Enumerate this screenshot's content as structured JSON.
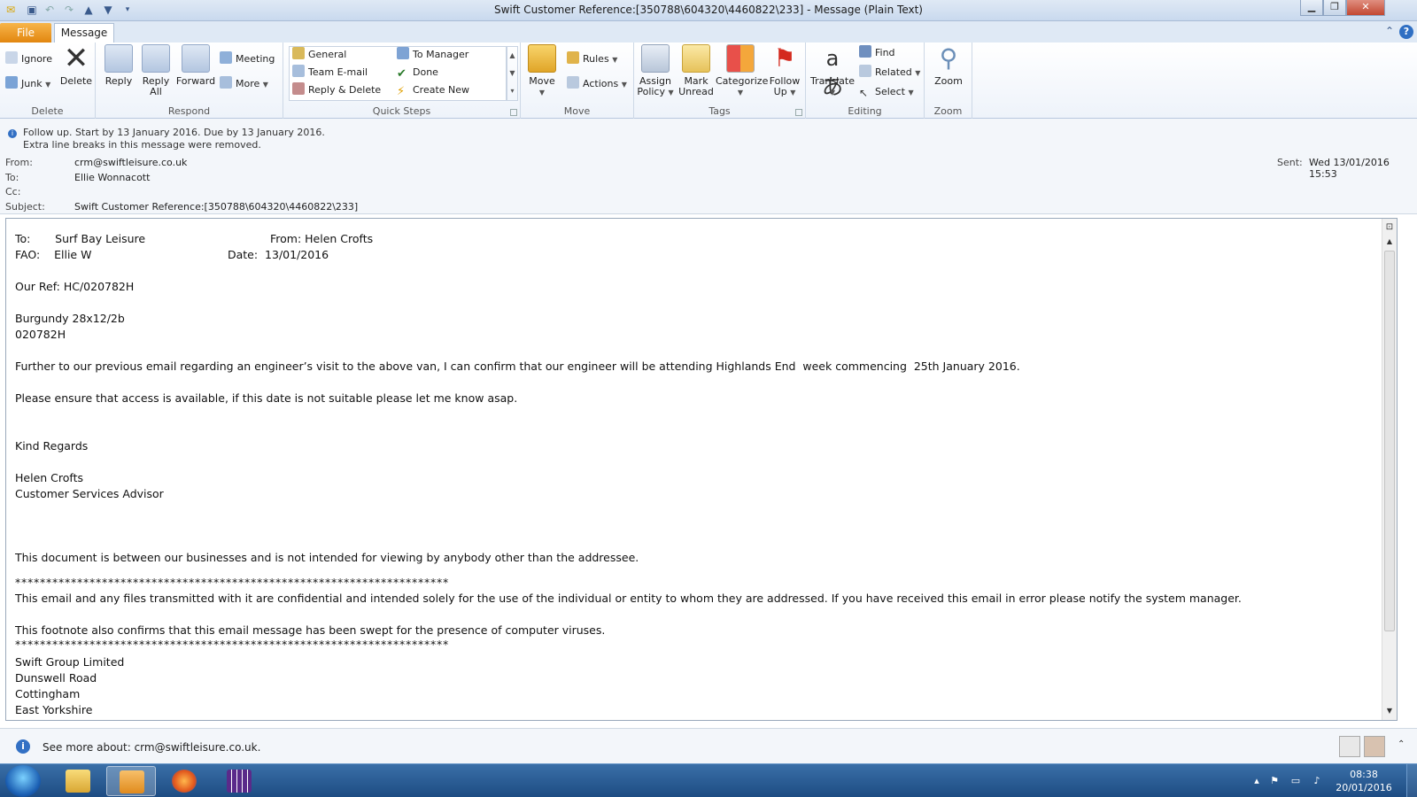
{
  "window": {
    "title": "Swift Customer Reference:[350788\\604320\\4460822\\233]  -  Message (Plain Text)"
  },
  "tabs": {
    "file": "File",
    "message": "Message"
  },
  "ribbon": {
    "delete_group": {
      "label": "Delete",
      "ignore": "Ignore",
      "junk": "Junk",
      "delete": "Delete"
    },
    "respond_group": {
      "label": "Respond",
      "reply": "Reply",
      "reply_all_1": "Reply",
      "reply_all_2": "All",
      "forward": "Forward",
      "meeting": "Meeting",
      "more": "More"
    },
    "quicksteps_group": {
      "label": "Quick Steps",
      "items": [
        "General",
        "Team E-mail",
        "Reply & Delete",
        "To Manager",
        "Done",
        "Create New"
      ]
    },
    "move_group": {
      "label": "Move",
      "move": "Move",
      "rules": "Rules",
      "actions": "Actions"
    },
    "tags_group": {
      "label": "Tags",
      "assign_1": "Assign",
      "assign_2": "Policy",
      "mark_1": "Mark",
      "mark_2": "Unread",
      "categorize": "Categorize",
      "follow_1": "Follow",
      "follow_2": "Up"
    },
    "editing_group": {
      "label": "Editing",
      "translate": "Translate",
      "find": "Find",
      "related": "Related",
      "select": "Select"
    },
    "zoom_group": {
      "label": "Zoom",
      "zoom": "Zoom"
    }
  },
  "info": {
    "line1": "Follow up.  Start by 13 January 2016.  Due by 13 January 2016.",
    "line2": "Extra line breaks in this message were removed."
  },
  "header": {
    "from_label": "From:",
    "from_value": "crm@swiftleisure.co.uk",
    "to_label": "To:",
    "to_value": "Ellie Wonnacott",
    "cc_label": "Cc:",
    "cc_value": "",
    "subject_label": "Subject:",
    "subject_value": "Swift Customer Reference:[350788\\604320\\4460822\\233]",
    "sent_label": "Sent:",
    "sent_value": "Wed 13/01/2016 15:53"
  },
  "body": {
    "to_line": "To:       Surf Bay Leisure",
    "from_line": "From: Helen Crofts",
    "fao_line": "FAO:    Ellie W",
    "date_line": "Date:  13/01/2016",
    "ref": "Our Ref: HC/020782H",
    "van": "Burgundy 28x12/2b",
    "van_ref": "020782H",
    "para1": "Further to our previous email regarding an engineer’s visit to the above van, I can confirm that our engineer will be attending Highlands End  week commencing  25th January 2016.",
    "para2": "Please ensure that access is available, if this date is not suitable please let me know asap.",
    "regards": "Kind Regards",
    "sig_name": "Helen Crofts",
    "sig_title": "Customer Services Advisor",
    "notice": "This document is between our businesses and is not intended for viewing by anybody other than the addressee.",
    "stars": "**********************************************************************",
    "confidential": "This email and any files transmitted with it are confidential and intended solely for the use of the individual or entity to whom they are addressed. If you have received this email in error please notify the system manager.",
    "footnote": "This footnote also confirms that this email message has been swept for the presence of computer viruses.",
    "addr1": "Swift Group Limited",
    "addr2": "Dunswell Road",
    "addr3": "Cottingham",
    "addr4": "East Yorkshire"
  },
  "people": {
    "see_more": "See more about: crm@swiftleisure.co.uk."
  },
  "taskbar": {
    "time": "08:38",
    "date": "20/01/2016"
  },
  "colors": {
    "accent": "#2f6fc3",
    "file_tab": "#e2860f",
    "taskbar": "#1d4c83"
  }
}
